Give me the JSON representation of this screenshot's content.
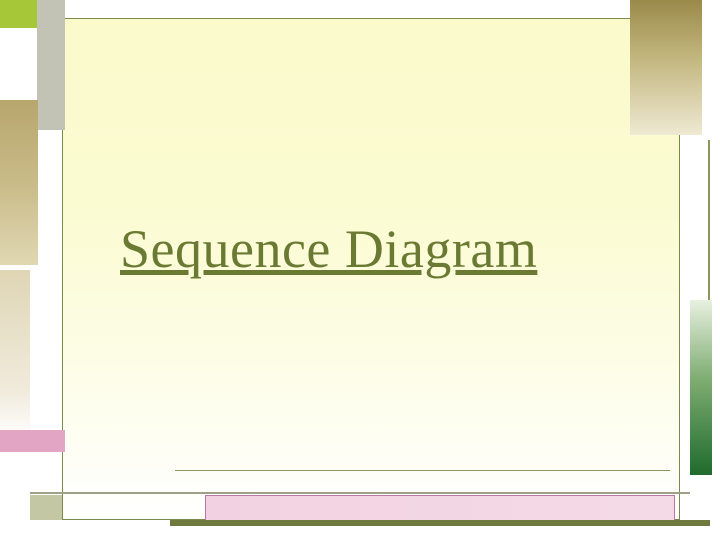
{
  "slide": {
    "title": "Sequence Diagram"
  },
  "colors": {
    "title_text": "#6a7a32",
    "panel_border": "#7a8a4a",
    "accent_lime": "#a6c838",
    "accent_pink": "#e3a5c4",
    "accent_olive": "#9a8a4a",
    "accent_green": "#1f6b2c"
  }
}
